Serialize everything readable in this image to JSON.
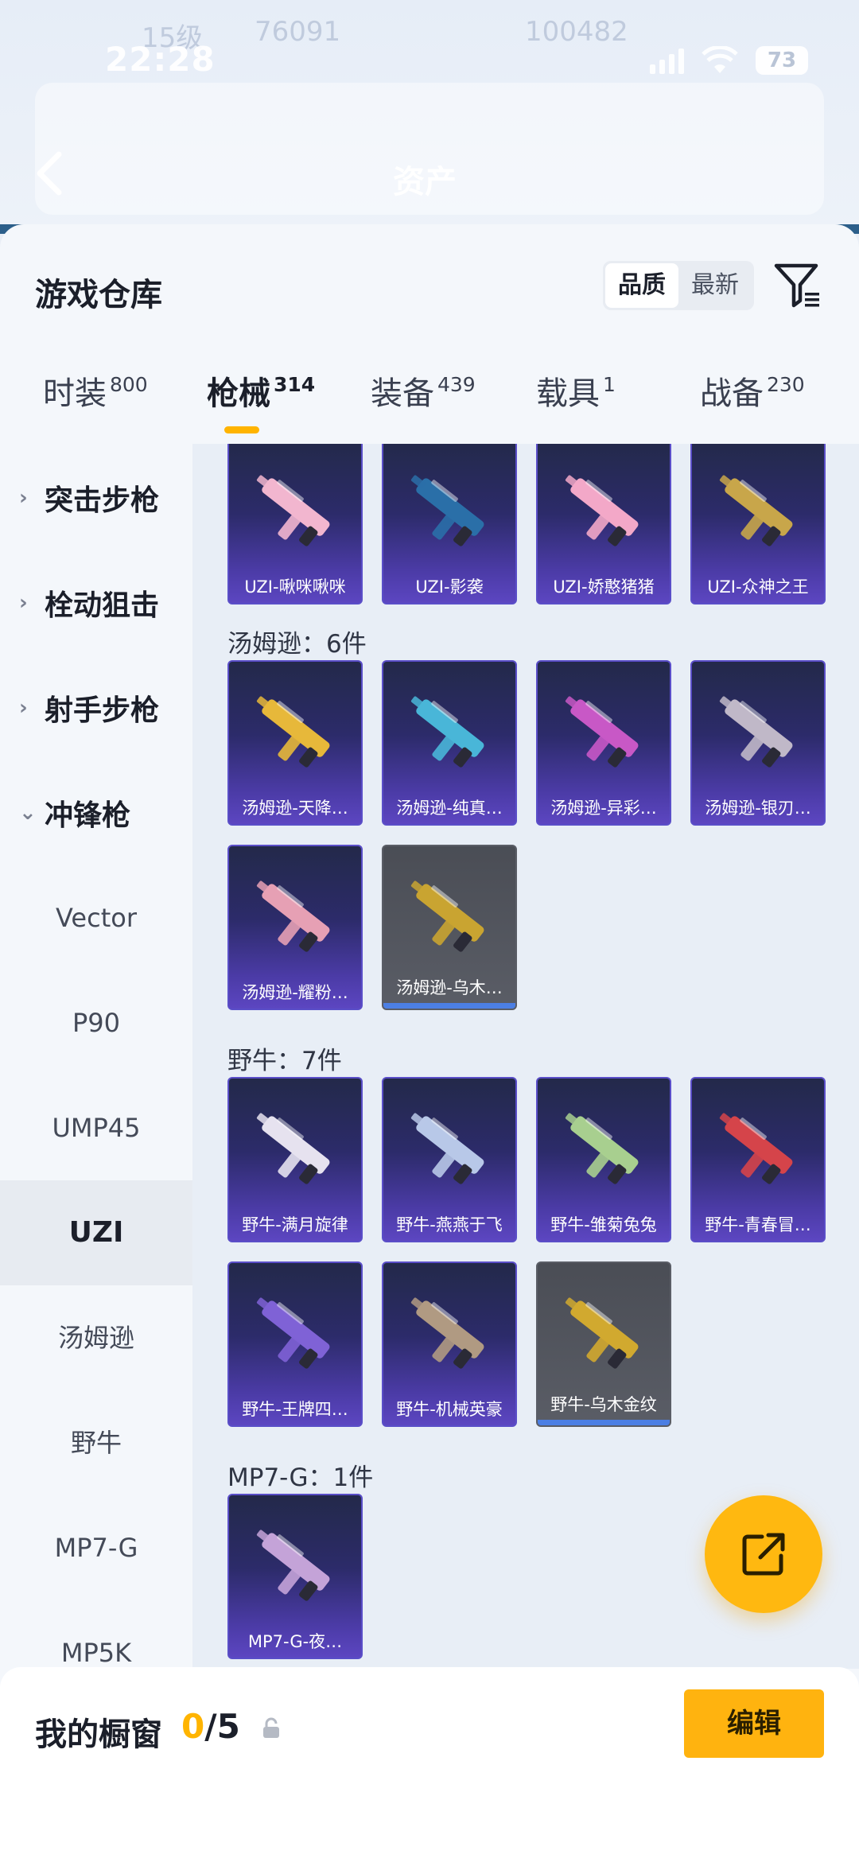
{
  "status_bar": {
    "time": "22:28",
    "battery": "73"
  },
  "header": {
    "title": "资产",
    "ghost_level": "15级",
    "ghost_coins": "76091",
    "ghost_points": "100482"
  },
  "panel": {
    "title": "游戏仓库",
    "sort": {
      "options": [
        "品质",
        "最新"
      ],
      "active": "品质"
    }
  },
  "tabs": [
    {
      "label": "时装",
      "count": "800"
    },
    {
      "label": "枪械",
      "count": "314",
      "active": true
    },
    {
      "label": "装备",
      "count": "439"
    },
    {
      "label": "载具",
      "count": "1"
    },
    {
      "label": "战备",
      "count": "230"
    }
  ],
  "sidebar": {
    "categories": [
      {
        "label": "突击步枪",
        "expanded": false
      },
      {
        "label": "栓动狙击",
        "expanded": false
      },
      {
        "label": "射手步枪",
        "expanded": false
      },
      {
        "label": "冲锋枪",
        "expanded": true
      }
    ],
    "subs": [
      "Vector",
      "P90",
      "UMP45",
      "UZI",
      "汤姆逊",
      "野牛",
      "MP7-G",
      "MP5K"
    ],
    "active_sub": "UZI"
  },
  "groups": [
    {
      "title": "",
      "items": [
        "UZI-啾咪啾咪",
        "UZI-影袭",
        "UZI-娇憨猪猪",
        "UZI-众神之王"
      ]
    },
    {
      "title": "汤姆逊：6件",
      "items": [
        "汤姆逊-天降…",
        "汤姆逊-纯真…",
        "汤姆逊-异彩…",
        "汤姆逊-银刃…",
        "汤姆逊-耀粉…",
        "汤姆逊-乌木…"
      ]
    },
    {
      "title": "野牛：7件",
      "items": [
        "野牛-满月旋律",
        "野牛-燕燕于飞",
        "野牛-雏菊兔兔",
        "野牛-青春冒…",
        "野牛-王牌四…",
        "野牛-机械英豪",
        "野牛-乌木金纹"
      ]
    },
    {
      "title": "MP7-G：1件",
      "items": [
        "MP7-G-夜…"
      ]
    }
  ],
  "item_colors": {
    "UZI-啾咪啾咪": "#f2b6cf",
    "UZI-影袭": "#2a6fa8",
    "UZI-娇憨猪猪": "#f3a8c8",
    "UZI-众神之王": "#c8a64a",
    "汤姆逊-天降…": "#e7b83a",
    "汤姆逊-纯真…": "#49b6d8",
    "汤姆逊-异彩…": "#c858c6",
    "汤姆逊-银刃…": "#c0b8c8",
    "汤姆逊-耀粉…": "#e6a0b4",
    "汤姆逊-乌木…": "#c9a431",
    "野牛-满月旋律": "#e6e2ef",
    "野牛-燕燕于飞": "#b8c8e8",
    "野牛-雏菊兔兔": "#a8cf8f",
    "野牛-青春冒…": "#d5444a",
    "野牛-王牌四…": "#7f62d6",
    "野牛-机械英豪": "#b09a82",
    "野牛-乌木金纹": "#d1a92f",
    "MP7-G-夜…": "#c4a3d8"
  },
  "gray_items": [
    "汤姆逊-乌木…",
    "野牛-乌木金纹"
  ],
  "bottom": {
    "title": "我的橱窗",
    "count_current": "0",
    "count_total": "/5",
    "edit_label": "编辑"
  },
  "colors": {
    "accent": "#ffb400",
    "card_purple": "#4b3ba6"
  }
}
